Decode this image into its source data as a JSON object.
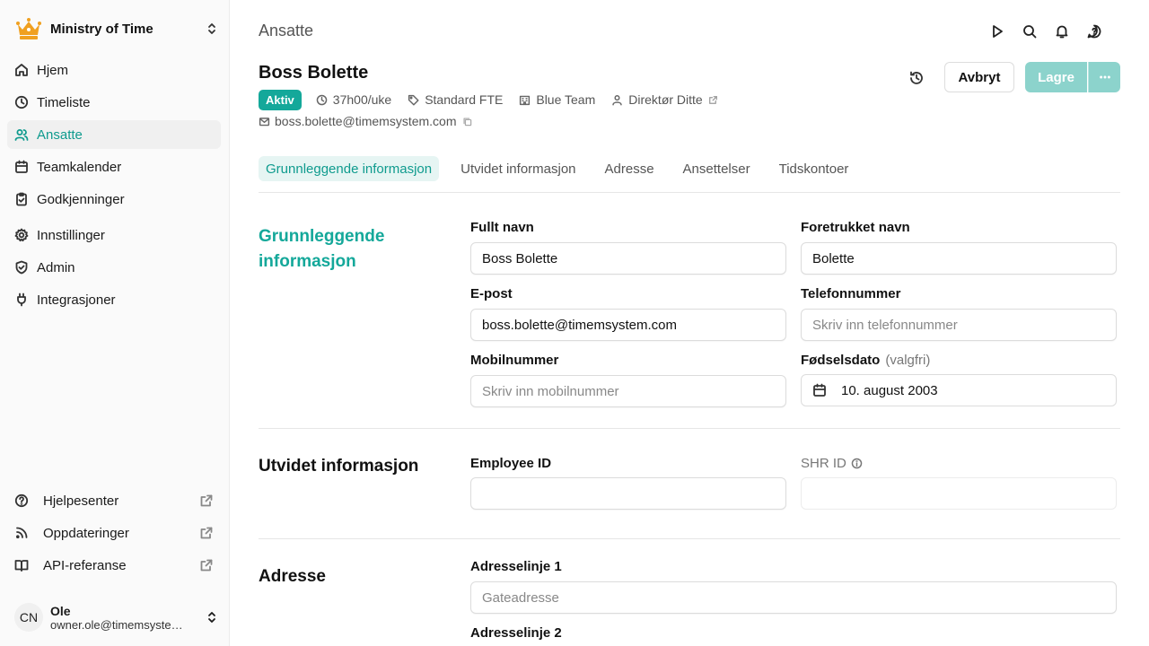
{
  "sidebar": {
    "org_name": "Ministry of Time",
    "nav": [
      {
        "label": "Hjem",
        "icon": "home-icon"
      },
      {
        "label": "Timeliste",
        "icon": "clock-icon"
      },
      {
        "label": "Ansatte",
        "icon": "users-icon",
        "active": true
      },
      {
        "label": "Teamkalender",
        "icon": "calendar-icon"
      },
      {
        "label": "Godkjenninger",
        "icon": "clipboard-check-icon"
      },
      {
        "label": "Innstillinger",
        "icon": "gear-icon"
      },
      {
        "label": "Admin",
        "icon": "shield-check-icon"
      },
      {
        "label": "Integrasjoner",
        "icon": "plug-icon"
      }
    ],
    "footer": [
      {
        "label": "Hjelpesenter",
        "icon": "help-circle-icon"
      },
      {
        "label": "Oppdateringer",
        "icon": "rss-icon"
      },
      {
        "label": "API-referanse",
        "icon": "book-icon"
      }
    ],
    "user": {
      "initials": "CN",
      "name": "Ole",
      "email": "owner.ole@timemsystem.com"
    }
  },
  "header": {
    "breadcrumb": "Ansatte"
  },
  "employee": {
    "name": "Boss Bolette",
    "status": "Aktiv",
    "hours": "37h00/uke",
    "fte": "Standard FTE",
    "team": "Blue Team",
    "manager": "Direktør Ditte",
    "email": "boss.bolette@timemsystem.com"
  },
  "actions": {
    "cancel": "Avbryt",
    "save": "Lagre"
  },
  "tabs": [
    "Grunnleggende informasjon",
    "Utvidet informasjon",
    "Adresse",
    "Ansettelser",
    "Tidskontoer"
  ],
  "basic": {
    "title": "Grunnleggende informasjon",
    "full_name_label": "Fullt navn",
    "full_name_value": "Boss Bolette",
    "preferred_label": "Foretrukket navn",
    "preferred_value": "Bolette",
    "email_label": "E-post",
    "email_value": "boss.bolette@timemsystem.com",
    "phone_label": "Telefonnummer",
    "phone_placeholder": "Skriv inn telefonnummer",
    "mobile_label": "Mobilnummer",
    "mobile_placeholder": "Skriv inn mobilnummer",
    "birth_label": "Fødselsdato",
    "birth_optional": "(valgfri)",
    "birth_value": "10. august 2003"
  },
  "extended": {
    "title": "Utvidet informasjon",
    "employee_id_label": "Employee ID",
    "shr_id_label": "SHR ID"
  },
  "address": {
    "title": "Adresse",
    "line1_label": "Adresselinje 1",
    "line1_placeholder": "Gateadresse",
    "line2_label": "Adresselinje 2"
  },
  "colors": {
    "accent": "#14a89a",
    "accent_light": "#8cd3cc",
    "crown": "#f0a020"
  }
}
